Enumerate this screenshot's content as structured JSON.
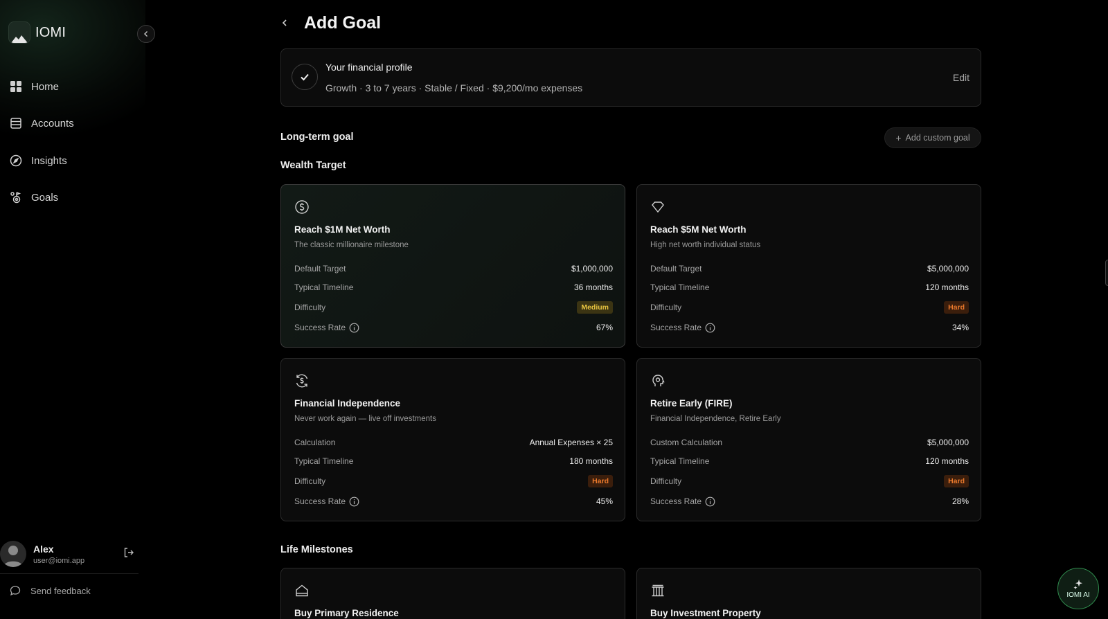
{
  "app": {
    "name": "IOMI"
  },
  "sidebar": {
    "items": [
      {
        "label": "Home",
        "icon": "grid-icon"
      },
      {
        "label": "Accounts",
        "icon": "list-icon"
      },
      {
        "label": "Insights",
        "icon": "compass-icon"
      },
      {
        "label": "Goals",
        "icon": "goals-icon"
      }
    ],
    "user": {
      "name": "Alex",
      "email": "user@iomi.app"
    },
    "feedback_label": "Send feedback"
  },
  "header": {
    "title": "Add Goal"
  },
  "profile": {
    "title": "Your financial profile",
    "summary": "Growth · 3 to 7 years · Stable / Fixed · $9,200/mo expenses",
    "edit_label": "Edit"
  },
  "sections": {
    "long_term": "Long-term goal",
    "add_custom": "Add custom goal",
    "wealth_target": "Wealth Target",
    "life_milestones": "Life Milestones"
  },
  "cards": [
    {
      "title": "Reach $1M Net Worth",
      "desc": "The classic millionaire milestone",
      "rows": [
        {
          "k": "Default Target",
          "v": "$1,000,000"
        },
        {
          "k": "Typical Timeline",
          "v": "36 months"
        },
        {
          "k": "Difficulty",
          "v": "Medium"
        },
        {
          "k": "Success Rate",
          "v": "67%"
        }
      ]
    },
    {
      "title": "Reach $5M Net Worth",
      "desc": "High net worth individual status",
      "rows": [
        {
          "k": "Default Target",
          "v": "$5,000,000"
        },
        {
          "k": "Typical Timeline",
          "v": "120 months"
        },
        {
          "k": "Difficulty",
          "v": "Hard"
        },
        {
          "k": "Success Rate",
          "v": "34%"
        }
      ]
    },
    {
      "title": "Financial Independence",
      "desc": "Never work again — live off investments",
      "rows": [
        {
          "k": "Calculation",
          "v": "Annual Expenses × 25"
        },
        {
          "k": "Typical Timeline",
          "v": "180 months"
        },
        {
          "k": "Difficulty",
          "v": "Hard"
        },
        {
          "k": "Success Rate",
          "v": "45%"
        }
      ]
    },
    {
      "title": "Retire Early (FIRE)",
      "desc": "Financial Independence, Retire Early",
      "rows": [
        {
          "k": "Custom Calculation",
          "v": "$5,000,000"
        },
        {
          "k": "Typical Timeline",
          "v": "120 months"
        },
        {
          "k": "Difficulty",
          "v": "Hard"
        },
        {
          "k": "Success Rate",
          "v": "28%"
        }
      ]
    },
    {
      "title": "Buy Primary Residence"
    },
    {
      "title": "Buy Investment Property"
    }
  ],
  "ai_button": {
    "label": "IOMI AI"
  },
  "colors": {
    "accent": "#2f8a4c",
    "medium": "#e8c440",
    "hard": "#ec7a2c"
  }
}
